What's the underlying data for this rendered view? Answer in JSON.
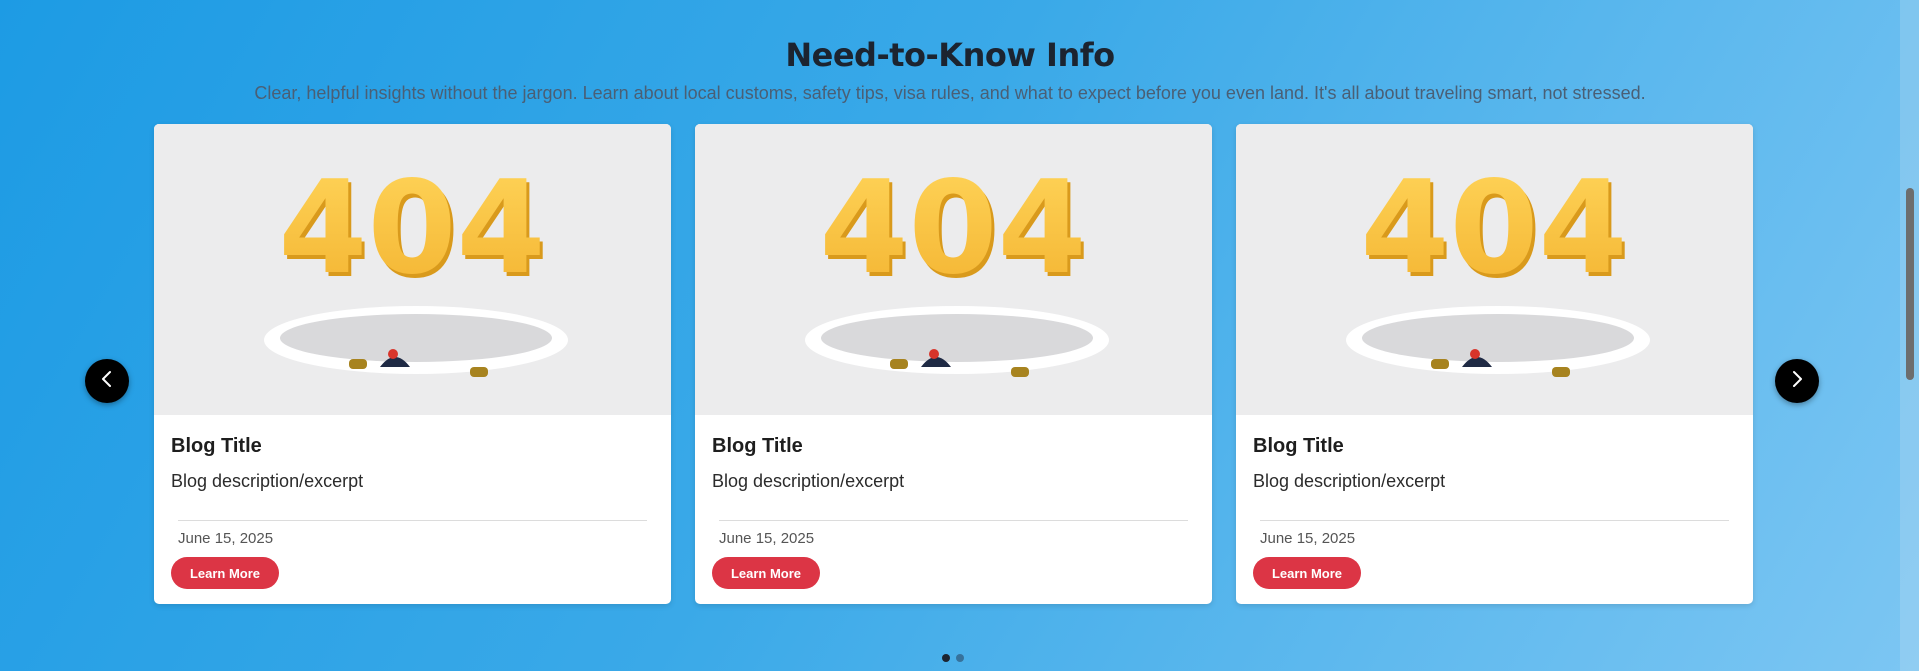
{
  "section": {
    "title": "Need-to-Know Info",
    "subtitle": "Clear, helpful insights without the jargon. Learn about local customs, safety tips, visa rules, and what to expect before you even land. It's all about traveling smart, not stressed."
  },
  "cards": [
    {
      "image_text": "404",
      "title": "Blog Title",
      "description": "Blog description/excerpt",
      "date": "June 15, 2025",
      "button_label": "Learn More"
    },
    {
      "image_text": "404",
      "title": "Blog Title",
      "description": "Blog description/excerpt",
      "date": "June 15, 2025",
      "button_label": "Learn More"
    },
    {
      "image_text": "404",
      "title": "Blog Title",
      "description": "Blog description/excerpt",
      "date": "June 15, 2025",
      "button_label": "Learn More"
    }
  ],
  "carousel": {
    "prev_icon": "chevron-left-icon",
    "next_icon": "chevron-right-icon",
    "pages": 2,
    "active_page": 1
  },
  "colors": {
    "button": "#dc3545",
    "title": "#1c2430",
    "digits": "#f6bf3a"
  }
}
